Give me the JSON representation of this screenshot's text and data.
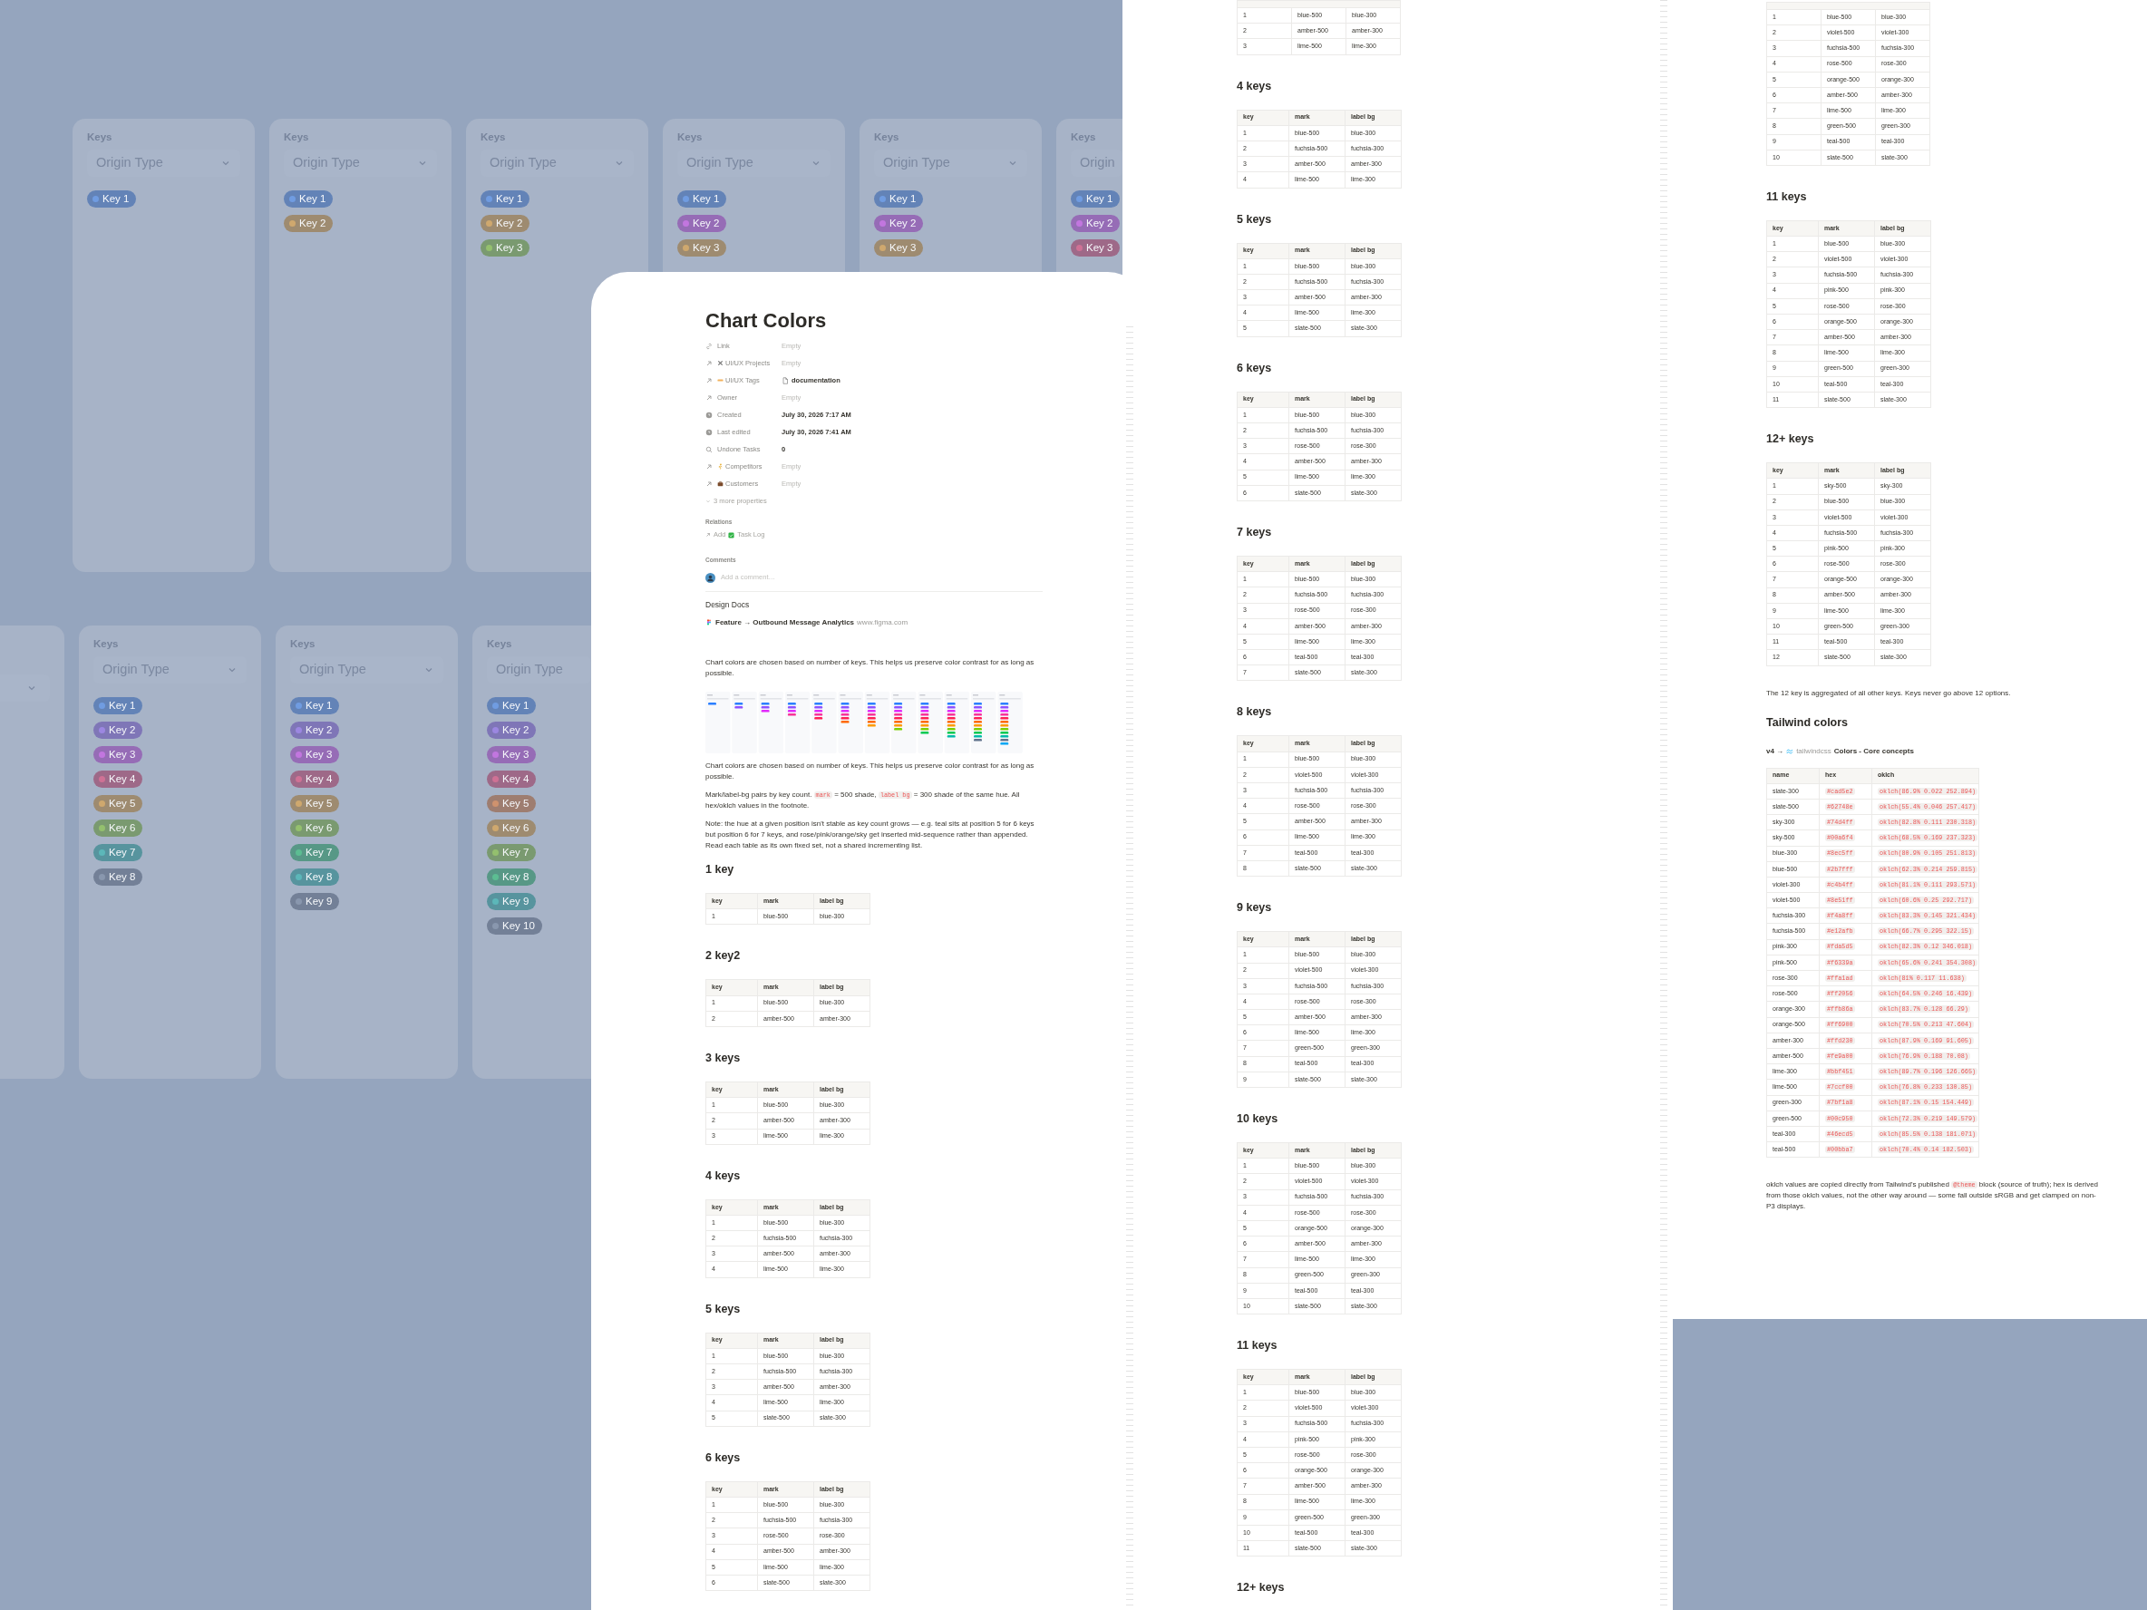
{
  "key_card_rows": [
    {
      "cards": [
        {
          "kind": "full",
          "title": "Keys",
          "select": "Origin Type",
          "chips": [
            {
              "label": "Key 1",
              "color": "#709ce1"
            }
          ]
        },
        {
          "kind": "full",
          "title": "Keys",
          "select": "Origin Type",
          "chips": [
            {
              "label": "Key 1",
              "color": "#709ce1"
            },
            {
              "label": "Key 2",
              "color": "#cfa86e"
            }
          ]
        },
        {
          "kind": "full",
          "title": "Keys",
          "select": "Origin Type",
          "chips": [
            {
              "label": "Key 1",
              "color": "#709ce1"
            },
            {
              "label": "Key 2",
              "color": "#cfa86e"
            },
            {
              "label": "Key 3",
              "color": "#94c06e"
            }
          ]
        },
        {
          "kind": "full",
          "title": "Keys",
          "select": "Origin Type",
          "chips": [
            {
              "label": "Key 1",
              "color": "#709ce1"
            },
            {
              "label": "Key 2",
              "color": "#c276df"
            },
            {
              "label": "Key 3",
              "color": "#cfa86e"
            }
          ]
        },
        {
          "kind": "full",
          "title": "Keys",
          "select": "Origin Type",
          "chips": [
            {
              "label": "Key 1",
              "color": "#709ce1"
            },
            {
              "label": "Key 2",
              "color": "#c276df"
            },
            {
              "label": "Key 3",
              "color": "#cfa86e"
            }
          ]
        },
        {
          "kind": "cut",
          "title": "Keys",
          "select": "Origin",
          "chips": [
            {
              "label": "Key 1",
              "color": "#709ce1"
            },
            {
              "label": "Key 2",
              "color": "#c276df"
            },
            {
              "label": "Key 3",
              "color": "#cf7195"
            }
          ]
        }
      ]
    },
    {
      "cards": [
        {
          "kind": "partial"
        },
        {
          "kind": "full",
          "title": "Keys",
          "select": "Origin Type",
          "chips": [
            {
              "label": "Key 1",
              "color": "#709ce1"
            },
            {
              "label": "Key 2",
              "color": "#9c87e1"
            },
            {
              "label": "Key 3",
              "color": "#c276df"
            },
            {
              "label": "Key 4",
              "color": "#cf7195"
            },
            {
              "label": "Key 5",
              "color": "#cfa86e"
            },
            {
              "label": "Key 6",
              "color": "#94c06e"
            },
            {
              "label": "Key 7",
              "color": "#5cb7b9"
            },
            {
              "label": "Key 8",
              "color": "#8997ae"
            }
          ]
        },
        {
          "kind": "full",
          "title": "Keys",
          "select": "Origin Type",
          "chips": [
            {
              "label": "Key 1",
              "color": "#709ce1"
            },
            {
              "label": "Key 2",
              "color": "#9c87e1"
            },
            {
              "label": "Key 3",
              "color": "#c276df"
            },
            {
              "label": "Key 4",
              "color": "#cf7195"
            },
            {
              "label": "Key 5",
              "color": "#cfa86e"
            },
            {
              "label": "Key 6",
              "color": "#94c06e"
            },
            {
              "label": "Key 7",
              "color": "#5cbd92"
            },
            {
              "label": "Key 8",
              "color": "#5cb7b9"
            },
            {
              "label": "Key 9",
              "color": "#8997ae"
            }
          ]
        },
        {
          "kind": "cut",
          "title": "Keys",
          "select": "Origin Type",
          "chips": [
            {
              "label": "Key 1",
              "color": "#709ce1"
            },
            {
              "label": "Key 2",
              "color": "#9c87e1"
            },
            {
              "label": "Key 3",
              "color": "#c276df"
            },
            {
              "label": "Key 4",
              "color": "#cf7195"
            },
            {
              "label": "Key 5",
              "color": "#cf926e"
            },
            {
              "label": "Key 6",
              "color": "#cfa86e"
            },
            {
              "label": "Key 7",
              "color": "#94c06e"
            },
            {
              "label": "Key 8",
              "color": "#5cbd92"
            },
            {
              "label": "Key 9",
              "color": "#5cb7b9"
            },
            {
              "label": "Key 10",
              "color": "#8997ae"
            }
          ]
        }
      ]
    }
  ],
  "document": {
    "title": "Chart Colors",
    "properties": [
      {
        "label": "Link",
        "value": "Empty",
        "kind": "text",
        "empty": true
      },
      {
        "label": "UI/UX Projects",
        "value": "Empty",
        "kind": "text",
        "empty": true
      },
      {
        "label": "UI/UX Tags",
        "value": "documentation",
        "kind": "page",
        "empty": false
      },
      {
        "label": "Owner",
        "value": "Empty",
        "kind": "text",
        "empty": true
      },
      {
        "label": "Created",
        "value": "July 30, 2026 7:17 AM",
        "kind": "text",
        "empty": false
      },
      {
        "label": "Last edited",
        "value": "July 30, 2026 7:41 AM",
        "kind": "text",
        "empty": false
      },
      {
        "label": "Undone Tasks",
        "value": "0",
        "kind": "text",
        "empty": false
      },
      {
        "label": "Competitors",
        "value": "Empty",
        "kind": "text",
        "empty": true
      },
      {
        "label": "Customers",
        "value": "Empty",
        "kind": "text",
        "empty": true
      }
    ],
    "more_properties": "3 more properties",
    "relations": {
      "label": "Relations",
      "action": "Add",
      "item": "Task Log"
    },
    "comments": {
      "label": "Comments",
      "placeholder": "Add a comment…"
    },
    "design_docs": "Design Docs",
    "link": {
      "title": "Feature → Outbound Message Analytics",
      "site": "www.figma.com"
    },
    "blocks": [
      {
        "kind": "paragraph",
        "segments": [
          {
            "text": "Chart colors are chosen based on number of keys. This helps us preserve color contrast for as long as possible."
          }
        ]
      },
      {
        "kind": "preview"
      },
      {
        "kind": "paragraph",
        "segments": [
          {
            "text": "Chart colors are chosen based on number of keys. This helps us preserve color contrast for as long as possible."
          }
        ]
      },
      {
        "kind": "paragraph",
        "segments": [
          {
            "text": "Mark/label-bg pairs by key count. "
          },
          {
            "code": "mark"
          },
          {
            "text": " = 500 shade, "
          },
          {
            "code": "label bg"
          },
          {
            "text": " = 300 shade of the same hue. All hex/oklch values in the footnote."
          }
        ]
      },
      {
        "kind": "paragraph",
        "segments": [
          {
            "text": "Note: the hue at a given position isn't stable as key count grows — e.g. teal sits at position 5 for 6 keys but position 6 for 7 keys, and rose/pink/orange/sky get inserted mid-sequence rather than appended. Read each table as its own fixed set, not a shared incrementing list."
          }
        ]
      },
      {
        "kind": "section",
        "heading": "1 key",
        "columns": [
          "key",
          "mark",
          "label bg"
        ],
        "rows": [
          [
            "1",
            "blue-500",
            "blue-300"
          ]
        ]
      },
      {
        "kind": "section",
        "heading": "2 key2",
        "columns": [
          "key",
          "mark",
          "label bg"
        ],
        "rows": [
          [
            "1",
            "blue-500",
            "blue-300"
          ],
          [
            "2",
            "amber-500",
            "amber-300"
          ]
        ]
      },
      {
        "kind": "section",
        "heading": "3 keys",
        "columns": [
          "key",
          "mark",
          "label bg"
        ],
        "rows": [
          [
            "1",
            "blue-500",
            "blue-300"
          ],
          [
            "2",
            "amber-500",
            "amber-300"
          ],
          [
            "3",
            "lime-500",
            "lime-300"
          ]
        ]
      },
      {
        "kind": "section",
        "heading": "4 keys",
        "columns": [
          "key",
          "mark",
          "label bg"
        ],
        "rows": [
          [
            "1",
            "blue-500",
            "blue-300"
          ],
          [
            "2",
            "fuchsia-500",
            "fuchsia-300"
          ],
          [
            "3",
            "amber-500",
            "amber-300"
          ],
          [
            "4",
            "lime-500",
            "lime-300"
          ]
        ]
      },
      {
        "kind": "section",
        "heading": "5 keys",
        "columns": [
          "key",
          "mark",
          "label bg"
        ],
        "rows": [
          [
            "1",
            "blue-500",
            "blue-300"
          ],
          [
            "2",
            "fuchsia-500",
            "fuchsia-300"
          ],
          [
            "3",
            "amber-500",
            "amber-300"
          ],
          [
            "4",
            "lime-500",
            "lime-300"
          ],
          [
            "5",
            "slate-500",
            "slate-300"
          ]
        ]
      },
      {
        "kind": "section",
        "heading": "6 keys",
        "columns": [
          "key",
          "mark",
          "label bg"
        ],
        "rows": [
          [
            "1",
            "blue-500",
            "blue-300"
          ],
          [
            "2",
            "fuchsia-500",
            "fuchsia-300"
          ],
          [
            "3",
            "rose-500",
            "rose-300"
          ],
          [
            "4",
            "amber-500",
            "amber-300"
          ],
          [
            "5",
            "lime-500",
            "lime-300"
          ],
          [
            "6",
            "slate-500",
            "slate-300"
          ]
        ]
      }
    ]
  },
  "middle_page": {
    "blocks": [
      {
        "kind": "cut_section",
        "rows": [
          [
            "1",
            "blue-500",
            "blue-300"
          ],
          [
            "2",
            "amber-500",
            "amber-300"
          ],
          [
            "3",
            "lime-500",
            "lime-300"
          ]
        ]
      },
      {
        "kind": "section",
        "heading": "4 keys",
        "columns": [
          "key",
          "mark",
          "label bg"
        ],
        "rows": [
          [
            "1",
            "blue-500",
            "blue-300"
          ],
          [
            "2",
            "fuchsia-500",
            "fuchsia-300"
          ],
          [
            "3",
            "amber-500",
            "amber-300"
          ],
          [
            "4",
            "lime-500",
            "lime-300"
          ]
        ]
      },
      {
        "kind": "section",
        "heading": "5 keys",
        "columns": [
          "key",
          "mark",
          "label bg"
        ],
        "rows": [
          [
            "1",
            "blue-500",
            "blue-300"
          ],
          [
            "2",
            "fuchsia-500",
            "fuchsia-300"
          ],
          [
            "3",
            "amber-500",
            "amber-300"
          ],
          [
            "4",
            "lime-500",
            "lime-300"
          ],
          [
            "5",
            "slate-500",
            "slate-300"
          ]
        ]
      },
      {
        "kind": "section",
        "heading": "6 keys",
        "columns": [
          "key",
          "mark",
          "label bg"
        ],
        "rows": [
          [
            "1",
            "blue-500",
            "blue-300"
          ],
          [
            "2",
            "fuchsia-500",
            "fuchsia-300"
          ],
          [
            "3",
            "rose-500",
            "rose-300"
          ],
          [
            "4",
            "amber-500",
            "amber-300"
          ],
          [
            "5",
            "lime-500",
            "lime-300"
          ],
          [
            "6",
            "slate-500",
            "slate-300"
          ]
        ]
      },
      {
        "kind": "section",
        "heading": "7 keys",
        "columns": [
          "key",
          "mark",
          "label bg"
        ],
        "rows": [
          [
            "1",
            "blue-500",
            "blue-300"
          ],
          [
            "2",
            "fuchsia-500",
            "fuchsia-300"
          ],
          [
            "3",
            "rose-500",
            "rose-300"
          ],
          [
            "4",
            "amber-500",
            "amber-300"
          ],
          [
            "5",
            "lime-500",
            "lime-300"
          ],
          [
            "6",
            "teal-500",
            "teal-300"
          ],
          [
            "7",
            "slate-500",
            "slate-300"
          ]
        ]
      },
      {
        "kind": "section",
        "heading": "8 keys",
        "columns": [
          "key",
          "mark",
          "label bg"
        ],
        "rows": [
          [
            "1",
            "blue-500",
            "blue-300"
          ],
          [
            "2",
            "violet-500",
            "violet-300"
          ],
          [
            "3",
            "fuchsia-500",
            "fuchsia-300"
          ],
          [
            "4",
            "rose-500",
            "rose-300"
          ],
          [
            "5",
            "amber-500",
            "amber-300"
          ],
          [
            "6",
            "lime-500",
            "lime-300"
          ],
          [
            "7",
            "teal-500",
            "teal-300"
          ],
          [
            "8",
            "slate-500",
            "slate-300"
          ]
        ]
      },
      {
        "kind": "section",
        "heading": "9 keys",
        "columns": [
          "key",
          "mark",
          "label bg"
        ],
        "rows": [
          [
            "1",
            "blue-500",
            "blue-300"
          ],
          [
            "2",
            "violet-500",
            "violet-300"
          ],
          [
            "3",
            "fuchsia-500",
            "fuchsia-300"
          ],
          [
            "4",
            "rose-500",
            "rose-300"
          ],
          [
            "5",
            "amber-500",
            "amber-300"
          ],
          [
            "6",
            "lime-500",
            "lime-300"
          ],
          [
            "7",
            "green-500",
            "green-300"
          ],
          [
            "8",
            "teal-500",
            "teal-300"
          ],
          [
            "9",
            "slate-500",
            "slate-300"
          ]
        ]
      },
      {
        "kind": "section",
        "heading": "10 keys",
        "columns": [
          "key",
          "mark",
          "label bg"
        ],
        "rows": [
          [
            "1",
            "blue-500",
            "blue-300"
          ],
          [
            "2",
            "violet-500",
            "violet-300"
          ],
          [
            "3",
            "fuchsia-500",
            "fuchsia-300"
          ],
          [
            "4",
            "rose-500",
            "rose-300"
          ],
          [
            "5",
            "orange-500",
            "orange-300"
          ],
          [
            "6",
            "amber-500",
            "amber-300"
          ],
          [
            "7",
            "lime-500",
            "lime-300"
          ],
          [
            "8",
            "green-500",
            "green-300"
          ],
          [
            "9",
            "teal-500",
            "teal-300"
          ],
          [
            "10",
            "slate-500",
            "slate-300"
          ]
        ]
      },
      {
        "kind": "section",
        "heading": "11 keys",
        "columns": [
          "key",
          "mark",
          "label bg"
        ],
        "rows": [
          [
            "1",
            "blue-500",
            "blue-300"
          ],
          [
            "2",
            "violet-500",
            "violet-300"
          ],
          [
            "3",
            "fuchsia-500",
            "fuchsia-300"
          ],
          [
            "4",
            "pink-500",
            "pink-300"
          ],
          [
            "5",
            "rose-500",
            "rose-300"
          ],
          [
            "6",
            "orange-500",
            "orange-300"
          ],
          [
            "7",
            "amber-500",
            "amber-300"
          ],
          [
            "8",
            "lime-500",
            "lime-300"
          ],
          [
            "9",
            "green-500",
            "green-300"
          ],
          [
            "10",
            "teal-500",
            "teal-300"
          ],
          [
            "11",
            "slate-500",
            "slate-300"
          ]
        ]
      },
      {
        "kind": "heading",
        "text": "12+ keys"
      }
    ]
  },
  "right_page": {
    "blocks": [
      {
        "kind": "cut_section",
        "rows": [
          [
            "1",
            "blue-500",
            "blue-300"
          ],
          [
            "2",
            "violet-500",
            "violet-300"
          ],
          [
            "3",
            "fuchsia-500",
            "fuchsia-300"
          ],
          [
            "4",
            "rose-500",
            "rose-300"
          ],
          [
            "5",
            "orange-500",
            "orange-300"
          ],
          [
            "6",
            "amber-500",
            "amber-300"
          ],
          [
            "7",
            "lime-500",
            "lime-300"
          ],
          [
            "8",
            "green-500",
            "green-300"
          ],
          [
            "9",
            "teal-500",
            "teal-300"
          ],
          [
            "10",
            "slate-500",
            "slate-300"
          ]
        ]
      },
      {
        "kind": "section",
        "heading": "11 keys",
        "columns": [
          "key",
          "mark",
          "label bg"
        ],
        "rows": [
          [
            "1",
            "blue-500",
            "blue-300"
          ],
          [
            "2",
            "violet-500",
            "violet-300"
          ],
          [
            "3",
            "fuchsia-500",
            "fuchsia-300"
          ],
          [
            "4",
            "pink-500",
            "pink-300"
          ],
          [
            "5",
            "rose-500",
            "rose-300"
          ],
          [
            "6",
            "orange-500",
            "orange-300"
          ],
          [
            "7",
            "amber-500",
            "amber-300"
          ],
          [
            "8",
            "lime-500",
            "lime-300"
          ],
          [
            "9",
            "green-500",
            "green-300"
          ],
          [
            "10",
            "teal-500",
            "teal-300"
          ],
          [
            "11",
            "slate-500",
            "slate-300"
          ]
        ]
      },
      {
        "kind": "section",
        "heading": "12+ keys",
        "columns": [
          "key",
          "mark",
          "label bg"
        ],
        "rows": [
          [
            "1",
            "sky-500",
            "sky-300"
          ],
          [
            "2",
            "blue-500",
            "blue-300"
          ],
          [
            "3",
            "violet-500",
            "violet-300"
          ],
          [
            "4",
            "fuchsia-500",
            "fuchsia-300"
          ],
          [
            "5",
            "pink-500",
            "pink-300"
          ],
          [
            "6",
            "rose-500",
            "rose-300"
          ],
          [
            "7",
            "orange-500",
            "orange-300"
          ],
          [
            "8",
            "amber-500",
            "amber-300"
          ],
          [
            "9",
            "lime-500",
            "lime-300"
          ],
          [
            "10",
            "green-500",
            "green-300"
          ],
          [
            "11",
            "teal-500",
            "teal-300"
          ],
          [
            "12",
            "slate-500",
            "slate-300"
          ]
        ]
      },
      {
        "kind": "paragraph",
        "segments": [
          {
            "text": "The 12 key is aggregated of all other keys. Keys never go above 12 options."
          }
        ]
      },
      {
        "kind": "heading",
        "text": "Tailwind colors"
      },
      {
        "kind": "source",
        "prefix": "v4 →",
        "site": "tailwindcss",
        "title": "Colors - Core concepts"
      },
      {
        "kind": "color_table",
        "columns": [
          {
            "label": "name",
            "kind": "text"
          },
          {
            "label": "hex",
            "kind": "code"
          },
          {
            "label": "oklch",
            "kind": "code"
          }
        ],
        "rows": [
          [
            "slate-300",
            "#cad5e2",
            "oklch(86.9% 0.022 252.894)"
          ],
          [
            "slate-500",
            "#62748e",
            "oklch(55.4% 0.046 257.417)"
          ],
          [
            "sky-300",
            "#74d4ff",
            "oklch(82.8% 0.111 230.318)"
          ],
          [
            "sky-500",
            "#00a6f4",
            "oklch(68.5% 0.169 237.323)"
          ],
          [
            "blue-300",
            "#8ec5ff",
            "oklch(80.9% 0.105 251.813)"
          ],
          [
            "blue-500",
            "#2b7fff",
            "oklch(62.3% 0.214 259.815)"
          ],
          [
            "violet-300",
            "#c4b4ff",
            "oklch(81.1% 0.111 293.571)"
          ],
          [
            "violet-500",
            "#8e51ff",
            "oklch(60.6% 0.25 292.717)"
          ],
          [
            "fuchsia-300",
            "#f4a8ff",
            "oklch(83.3% 0.145 321.434)"
          ],
          [
            "fuchsia-500",
            "#e12afb",
            "oklch(66.7% 0.295 322.15)"
          ],
          [
            "pink-300",
            "#fda5d5",
            "oklch(82.3% 0.12 346.018)"
          ],
          [
            "pink-500",
            "#f6339a",
            "oklch(65.6% 0.241 354.308)"
          ],
          [
            "rose-300",
            "#ffa1ad",
            "oklch(81% 0.117 11.638)"
          ],
          [
            "rose-500",
            "#ff2056",
            "oklch(64.5% 0.246 16.439)"
          ],
          [
            "orange-300",
            "#ffb86a",
            "oklch(83.7% 0.128 66.29)"
          ],
          [
            "orange-500",
            "#ff6900",
            "oklch(70.5% 0.213 47.604)"
          ],
          [
            "amber-300",
            "#ffd230",
            "oklch(87.9% 0.169 91.605)"
          ],
          [
            "amber-500",
            "#fe9a00",
            "oklch(76.9% 0.188 70.08)"
          ],
          [
            "lime-300",
            "#bbf451",
            "oklch(89.7% 0.196 126.665)"
          ],
          [
            "lime-500",
            "#7ccf00",
            "oklch(76.8% 0.233 130.85)"
          ],
          [
            "green-300",
            "#7bf1a8",
            "oklch(87.1% 0.15 154.449)"
          ],
          [
            "green-500",
            "#00c950",
            "oklch(72.3% 0.219 149.579)"
          ],
          [
            "teal-300",
            "#46ecd5",
            "oklch(85.5% 0.138 181.071)"
          ],
          [
            "teal-500",
            "#00bba7",
            "oklch(70.4% 0.14 182.503)"
          ]
        ]
      },
      {
        "kind": "paragraph",
        "segments": [
          {
            "text": "oklch values are copied directly from Tailwind's published "
          },
          {
            "code": "@theme"
          },
          {
            "text": " block (source of truth); hex is derived from those oklch values, not the other way around — some fall outside sRGB and get clamped on non-P3 displays."
          }
        ]
      }
    ]
  }
}
